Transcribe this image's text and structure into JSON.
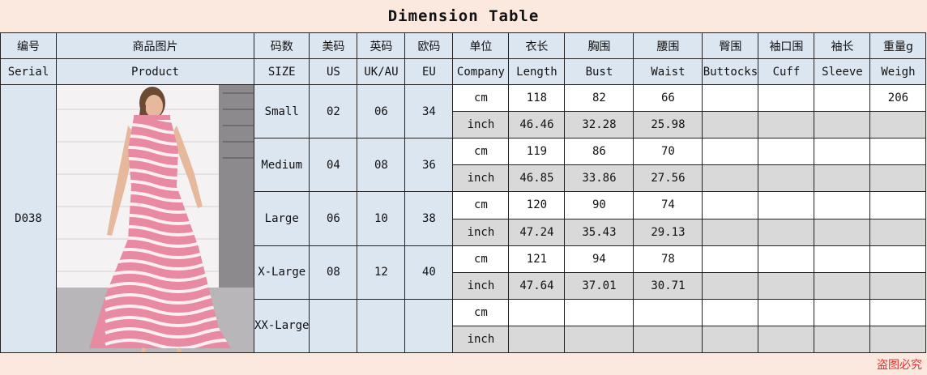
{
  "title": "Dimension Table",
  "header_cn": [
    "编号",
    "商品图片",
    "码数",
    "美码",
    "英码",
    "欧码",
    "单位",
    "衣长",
    "胸围",
    "腰围",
    "臀围",
    "袖口围",
    "袖长",
    "重量g"
  ],
  "header_en": [
    "Serial",
    "Product",
    "SIZE",
    "US",
    "UK/AU",
    "EU",
    "Company",
    "Length",
    "Bust",
    "Waist",
    "Buttocks",
    "Cuff",
    "Sleeve",
    "Weigh"
  ],
  "serial": "D038",
  "product_image": "pink-zebra-print-halter-midi-dress-photo",
  "sizes": [
    {
      "size": "Small",
      "us": "02",
      "uk": "06",
      "eu": "34",
      "cm": {
        "unit": "cm",
        "length": "118",
        "bust": "82",
        "waist": "66",
        "buttocks": "",
        "cuff": "",
        "sleeve": "",
        "weigh": "206"
      },
      "inch": {
        "unit": "inch",
        "length": "46.46",
        "bust": "32.28",
        "waist": "25.98",
        "buttocks": "",
        "cuff": "",
        "sleeve": "",
        "weigh": ""
      }
    },
    {
      "size": "Medium",
      "us": "04",
      "uk": "08",
      "eu": "36",
      "cm": {
        "unit": "cm",
        "length": "119",
        "bust": "86",
        "waist": "70",
        "buttocks": "",
        "cuff": "",
        "sleeve": "",
        "weigh": ""
      },
      "inch": {
        "unit": "inch",
        "length": "46.85",
        "bust": "33.86",
        "waist": "27.56",
        "buttocks": "",
        "cuff": "",
        "sleeve": "",
        "weigh": ""
      }
    },
    {
      "size": "Large",
      "us": "06",
      "uk": "10",
      "eu": "38",
      "cm": {
        "unit": "cm",
        "length": "120",
        "bust": "90",
        "waist": "74",
        "buttocks": "",
        "cuff": "",
        "sleeve": "",
        "weigh": ""
      },
      "inch": {
        "unit": "inch",
        "length": "47.24",
        "bust": "35.43",
        "waist": "29.13",
        "buttocks": "",
        "cuff": "",
        "sleeve": "",
        "weigh": ""
      }
    },
    {
      "size": "X-Large",
      "us": "08",
      "uk": "12",
      "eu": "40",
      "cm": {
        "unit": "cm",
        "length": "121",
        "bust": "94",
        "waist": "78",
        "buttocks": "",
        "cuff": "",
        "sleeve": "",
        "weigh": ""
      },
      "inch": {
        "unit": "inch",
        "length": "47.64",
        "bust": "37.01",
        "waist": "30.71",
        "buttocks": "",
        "cuff": "",
        "sleeve": "",
        "weigh": ""
      }
    },
    {
      "size": "XX-Large",
      "us": "",
      "uk": "",
      "eu": "",
      "cm": {
        "unit": "cm",
        "length": "",
        "bust": "",
        "waist": "",
        "buttocks": "",
        "cuff": "",
        "sleeve": "",
        "weigh": ""
      },
      "inch": {
        "unit": "inch",
        "length": "",
        "bust": "",
        "waist": "",
        "buttocks": "",
        "cuff": "",
        "sleeve": "",
        "weigh": ""
      }
    }
  ],
  "watermark": "盗图必究"
}
